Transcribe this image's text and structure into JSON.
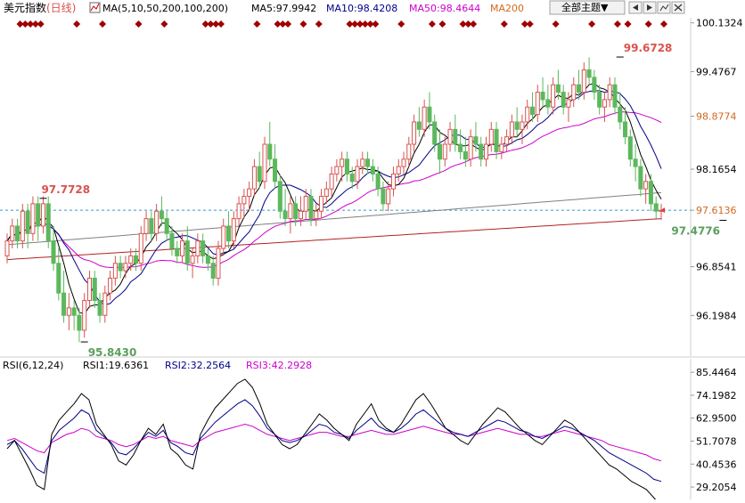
{
  "header": {
    "symbol": "美元指数",
    "period": "(日线)",
    "ma_label": "MA(5,10,50,200,100,200)",
    "ma5": "MA5:97.9942",
    "ma10": "MA10:98.4208",
    "ma50": "MA50:98.4644",
    "ma200": "MA200",
    "theme_button": "全部主题▼",
    "icons": [
      "prev-arrow-icon",
      "next-arrow-icon",
      "chart-type-icon",
      "close-icon"
    ]
  },
  "rsi_header": {
    "label": "RSI(6,12,24)",
    "rsi1": "RSI1:19.6361",
    "rsi2": "RSI2:32.2564",
    "rsi3": "RSI3:42.2928"
  },
  "colors": {
    "up": "#d9534f",
    "down": "#5cb85c",
    "ma5": "#000000",
    "ma10": "#00008b",
    "ma50": "#cc00cc",
    "ma100": "#808080",
    "ma200": "#b22222",
    "axis_highlight": "#d2691e",
    "marker": "#a00000",
    "hline": "#3399cc"
  },
  "chart_data": [
    {
      "type": "candlestick",
      "title": "美元指数(日线)",
      "y_ticks": [
        "100.1324",
        "99.4767",
        "98.8774",
        "98.1654",
        "97.6136",
        "96.8541",
        "96.1984"
      ],
      "y_tick_values": [
        100.1324,
        99.4767,
        98.8774,
        98.1654,
        97.6136,
        96.8541,
        96.1984
      ],
      "highlight_ticks": [
        "98.8774",
        "97.6136"
      ],
      "ylim": [
        95.7,
        100.2
      ],
      "current_price": 97.6136,
      "annotations": [
        {
          "text": "99.6728",
          "value": 99.6728,
          "index": 119
        },
        {
          "text": "97.7728",
          "value": 97.7728,
          "index": 7
        },
        {
          "text": "95.8430",
          "value": 95.843,
          "index": 15
        },
        {
          "text": "97.4776",
          "value": 97.4776,
          "index": 139
        }
      ],
      "candles": [
        [
          97.0,
          97.3,
          96.9,
          97.2
        ],
        [
          97.2,
          97.5,
          97.1,
          97.4
        ],
        [
          97.4,
          97.5,
          97.1,
          97.2
        ],
        [
          97.2,
          97.7,
          97.1,
          97.6
        ],
        [
          97.6,
          97.7,
          97.1,
          97.3
        ],
        [
          97.3,
          97.8,
          97.2,
          97.7
        ],
        [
          97.7,
          97.8,
          97.2,
          97.4
        ],
        [
          97.4,
          97.8,
          97.3,
          97.7
        ],
        [
          97.7,
          97.8,
          97.1,
          97.2
        ],
        [
          97.2,
          97.4,
          96.8,
          96.9
        ],
        [
          96.9,
          97.1,
          96.4,
          96.5
        ],
        [
          96.5,
          96.8,
          96.1,
          96.2
        ],
        [
          96.2,
          96.5,
          96.0,
          96.3
        ],
        [
          96.3,
          96.4,
          96.0,
          96.2
        ],
        [
          96.2,
          96.3,
          95.84,
          96.0
        ],
        [
          96.0,
          96.5,
          95.9,
          96.4
        ],
        [
          96.4,
          96.8,
          96.3,
          96.7
        ],
        [
          96.7,
          96.8,
          96.3,
          96.4
        ],
        [
          96.4,
          96.5,
          96.1,
          96.2
        ],
        [
          96.2,
          96.6,
          96.1,
          96.5
        ],
        [
          96.5,
          96.8,
          96.4,
          96.7
        ],
        [
          96.7,
          97.0,
          96.6,
          96.9
        ],
        [
          96.9,
          97.0,
          96.7,
          96.8
        ],
        [
          96.8,
          97.0,
          96.7,
          96.9
        ],
        [
          96.9,
          97.1,
          96.8,
          97.0
        ],
        [
          97.0,
          97.1,
          96.8,
          96.9
        ],
        [
          96.9,
          97.4,
          96.8,
          97.3
        ],
        [
          97.3,
          97.6,
          97.2,
          97.5
        ],
        [
          97.5,
          97.6,
          97.2,
          97.3
        ],
        [
          97.3,
          97.7,
          97.2,
          97.6
        ],
        [
          97.6,
          97.8,
          97.4,
          97.5
        ],
        [
          97.5,
          97.6,
          97.2,
          97.3
        ],
        [
          97.3,
          97.4,
          97.0,
          97.1
        ],
        [
          97.1,
          97.2,
          96.9,
          97.0
        ],
        [
          97.0,
          97.3,
          96.9,
          97.2
        ],
        [
          97.2,
          97.4,
          96.8,
          96.9
        ],
        [
          96.9,
          97.1,
          96.7,
          97.0
        ],
        [
          97.0,
          97.3,
          96.9,
          97.2
        ],
        [
          97.2,
          97.3,
          96.9,
          97.0
        ],
        [
          97.0,
          97.1,
          96.8,
          96.9
        ],
        [
          96.9,
          97.0,
          96.6,
          96.7
        ],
        [
          96.7,
          97.2,
          96.6,
          97.1
        ],
        [
          97.1,
          97.5,
          97.0,
          97.4
        ],
        [
          97.4,
          97.6,
          97.1,
          97.2
        ],
        [
          97.2,
          97.6,
          97.1,
          97.5
        ],
        [
          97.5,
          97.8,
          97.4,
          97.7
        ],
        [
          97.7,
          97.9,
          97.5,
          97.8
        ],
        [
          97.8,
          98.0,
          97.6,
          97.9
        ],
        [
          97.9,
          98.3,
          97.8,
          98.2
        ],
        [
          98.2,
          98.4,
          97.9,
          98.0
        ],
        [
          98.0,
          98.6,
          97.9,
          98.5
        ],
        [
          98.5,
          98.8,
          98.2,
          98.3
        ],
        [
          98.3,
          98.5,
          97.9,
          98.0
        ],
        [
          98.0,
          98.1,
          97.5,
          97.6
        ],
        [
          97.6,
          97.9,
          97.4,
          97.5
        ],
        [
          97.5,
          97.8,
          97.3,
          97.7
        ],
        [
          97.7,
          97.8,
          97.4,
          97.5
        ],
        [
          97.5,
          97.8,
          97.4,
          97.6
        ],
        [
          97.6,
          97.9,
          97.5,
          97.8
        ],
        [
          97.8,
          97.9,
          97.4,
          97.5
        ],
        [
          97.5,
          97.7,
          97.4,
          97.6
        ],
        [
          97.6,
          97.9,
          97.5,
          97.8
        ],
        [
          97.8,
          98.0,
          97.7,
          97.9
        ],
        [
          97.9,
          98.2,
          97.8,
          98.1
        ],
        [
          98.1,
          98.3,
          98.0,
          98.2
        ],
        [
          98.2,
          98.4,
          98.0,
          98.3
        ],
        [
          98.3,
          98.4,
          98.0,
          98.1
        ],
        [
          98.1,
          98.2,
          97.9,
          98.0
        ],
        [
          98.0,
          98.3,
          97.9,
          98.2
        ],
        [
          98.2,
          98.4,
          98.1,
          98.3
        ],
        [
          98.3,
          98.4,
          98.1,
          98.2
        ],
        [
          98.2,
          98.3,
          98.0,
          98.1
        ],
        [
          98.1,
          98.2,
          97.8,
          97.9
        ],
        [
          97.9,
          98.0,
          97.6,
          97.7
        ],
        [
          97.7,
          98.0,
          97.6,
          97.9
        ],
        [
          97.9,
          98.2,
          97.8,
          98.1
        ],
        [
          98.1,
          98.3,
          98.0,
          98.2
        ],
        [
          98.2,
          98.4,
          98.1,
          98.3
        ],
        [
          98.3,
          98.6,
          98.2,
          98.5
        ],
        [
          98.5,
          98.9,
          98.4,
          98.8
        ],
        [
          98.8,
          99.0,
          98.6,
          98.7
        ],
        [
          98.7,
          99.1,
          98.6,
          99.0
        ],
        [
          99.0,
          99.2,
          98.7,
          98.8
        ],
        [
          98.8,
          98.9,
          98.4,
          98.5
        ],
        [
          98.5,
          98.7,
          98.1,
          98.3
        ],
        [
          98.3,
          98.6,
          98.2,
          98.5
        ],
        [
          98.5,
          98.8,
          98.4,
          98.7
        ],
        [
          98.7,
          98.9,
          98.4,
          98.5
        ],
        [
          98.5,
          98.7,
          98.3,
          98.4
        ],
        [
          98.4,
          98.6,
          98.2,
          98.3
        ],
        [
          98.3,
          98.7,
          98.2,
          98.6
        ],
        [
          98.6,
          98.8,
          98.4,
          98.5
        ],
        [
          98.5,
          98.6,
          98.2,
          98.3
        ],
        [
          98.3,
          98.6,
          98.2,
          98.5
        ],
        [
          98.5,
          98.8,
          98.4,
          98.7
        ],
        [
          98.7,
          98.8,
          98.3,
          98.4
        ],
        [
          98.4,
          98.6,
          98.3,
          98.5
        ],
        [
          98.5,
          98.7,
          98.4,
          98.6
        ],
        [
          98.6,
          98.9,
          98.5,
          98.8
        ],
        [
          98.8,
          99.0,
          98.6,
          98.7
        ],
        [
          98.7,
          98.9,
          98.5,
          98.8
        ],
        [
          98.8,
          99.1,
          98.7,
          99.0
        ],
        [
          99.0,
          99.2,
          98.8,
          98.9
        ],
        [
          98.9,
          99.3,
          98.8,
          99.2
        ],
        [
          99.2,
          99.4,
          99.0,
          99.1
        ],
        [
          99.1,
          99.3,
          98.9,
          99.0
        ],
        [
          99.0,
          99.4,
          98.9,
          99.3
        ],
        [
          99.3,
          99.5,
          99.1,
          99.2
        ],
        [
          99.2,
          99.3,
          98.9,
          99.0
        ],
        [
          99.0,
          99.2,
          98.8,
          99.1
        ],
        [
          99.1,
          99.4,
          99.0,
          99.3
        ],
        [
          99.3,
          99.5,
          99.1,
          99.2
        ],
        [
          99.2,
          99.6,
          99.1,
          99.5
        ],
        [
          99.5,
          99.67,
          99.3,
          99.4
        ],
        [
          99.4,
          99.5,
          99.1,
          99.2
        ],
        [
          99.2,
          99.3,
          98.9,
          99.0
        ],
        [
          99.0,
          99.2,
          98.8,
          99.1
        ],
        [
          99.1,
          99.4,
          99.0,
          99.3
        ],
        [
          99.3,
          99.4,
          98.9,
          99.0
        ],
        [
          99.0,
          99.2,
          98.7,
          98.8
        ],
        [
          98.8,
          99.0,
          98.5,
          98.6
        ],
        [
          98.6,
          98.7,
          98.2,
          98.3
        ],
        [
          98.3,
          98.5,
          98.0,
          98.2
        ],
        [
          98.2,
          98.3,
          97.8,
          97.9
        ],
        [
          97.9,
          98.1,
          97.7,
          98.0
        ],
        [
          98.0,
          98.1,
          97.6,
          97.7
        ],
        [
          97.7,
          97.8,
          97.5,
          97.6
        ],
        [
          97.6,
          97.7,
          97.48,
          97.61
        ]
      ],
      "ma200_range": [
        96.95,
        97.5
      ],
      "ma100_range": [
        97.15,
        97.85
      ],
      "series": [
        {
          "name": "MA5",
          "last": 97.9942
        },
        {
          "name": "MA10",
          "last": 98.4208
        },
        {
          "name": "MA50",
          "last": 98.4644
        },
        {
          "name": "MA200"
        }
      ]
    },
    {
      "type": "line",
      "title": "RSI(6,12,24)",
      "y_ticks": [
        "85.4464",
        "74.1982",
        "62.9500",
        "51.7078",
        "40.4536",
        "29.2054"
      ],
      "y_tick_values": [
        85.4464,
        74.1982,
        62.95,
        51.7078,
        40.4536,
        29.2054
      ],
      "ylim": [
        24,
        89
      ],
      "series": [
        {
          "name": "RSI1",
          "last": 19.6361,
          "values": [
            48,
            52,
            45,
            38,
            30,
            28,
            55,
            62,
            66,
            70,
            75,
            72,
            60,
            55,
            50,
            42,
            40,
            45,
            52,
            58,
            55,
            60,
            48,
            45,
            40,
            38,
            55,
            62,
            68,
            72,
            76,
            80,
            82,
            78,
            70,
            60,
            55,
            50,
            48,
            50,
            55,
            60,
            65,
            62,
            58,
            55,
            52,
            60,
            65,
            70,
            62,
            58,
            56,
            60,
            66,
            72,
            75,
            70,
            64,
            58,
            55,
            52,
            50,
            55,
            60,
            64,
            68,
            66,
            62,
            58,
            55,
            52,
            50,
            54,
            58,
            62,
            60,
            56,
            52,
            48,
            44,
            40,
            38,
            35,
            32,
            30,
            28,
            24,
            20
          ]
        },
        {
          "name": "RSI2",
          "last": 32.2564,
          "values": [
            50,
            52,
            48,
            43,
            38,
            36,
            52,
            57,
            60,
            63,
            67,
            65,
            57,
            54,
            51,
            46,
            45,
            48,
            52,
            56,
            54,
            57,
            51,
            49,
            46,
            45,
            53,
            57,
            61,
            64,
            67,
            70,
            72,
            69,
            64,
            58,
            55,
            52,
            51,
            52,
            54,
            57,
            60,
            59,
            56,
            55,
            53,
            57,
            60,
            63,
            59,
            57,
            56,
            58,
            61,
            65,
            67,
            64,
            61,
            58,
            56,
            55,
            54,
            56,
            58,
            60,
            62,
            61,
            59,
            57,
            56,
            54,
            53,
            55,
            57,
            59,
            58,
            56,
            54,
            52,
            49,
            46,
            44,
            42,
            40,
            38,
            36,
            33,
            32
          ]
        },
        {
          "name": "RSI3",
          "last": 42.2928,
          "values": [
            52,
            53,
            51,
            49,
            47,
            46,
            51,
            53,
            55,
            56,
            58,
            57,
            54,
            53,
            52,
            50,
            49,
            50,
            52,
            54,
            53,
            54,
            52,
            51,
            50,
            49,
            52,
            54,
            56,
            57,
            58,
            59,
            60,
            59,
            57,
            55,
            54,
            53,
            52,
            53,
            54,
            55,
            56,
            56,
            55,
            54,
            54,
            55,
            56,
            57,
            56,
            55,
            55,
            56,
            57,
            58,
            59,
            58,
            57,
            56,
            55,
            55,
            54,
            55,
            56,
            57,
            58,
            57,
            56,
            55,
            55,
            54,
            54,
            55,
            56,
            57,
            56,
            55,
            54,
            53,
            52,
            50,
            49,
            48,
            47,
            46,
            45,
            43,
            42
          ]
        }
      ]
    }
  ]
}
